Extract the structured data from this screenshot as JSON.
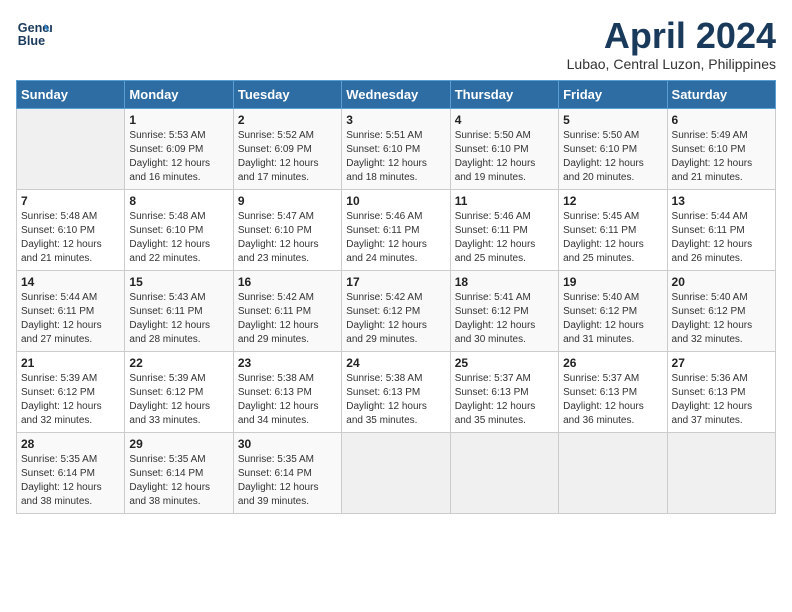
{
  "logo": {
    "line1": "General",
    "line2": "Blue"
  },
  "title": "April 2024",
  "subtitle": "Lubao, Central Luzon, Philippines",
  "headers": [
    "Sunday",
    "Monday",
    "Tuesday",
    "Wednesday",
    "Thursday",
    "Friday",
    "Saturday"
  ],
  "weeks": [
    [
      {
        "day": "",
        "info": ""
      },
      {
        "day": "1",
        "info": "Sunrise: 5:53 AM\nSunset: 6:09 PM\nDaylight: 12 hours\nand 16 minutes."
      },
      {
        "day": "2",
        "info": "Sunrise: 5:52 AM\nSunset: 6:09 PM\nDaylight: 12 hours\nand 17 minutes."
      },
      {
        "day": "3",
        "info": "Sunrise: 5:51 AM\nSunset: 6:10 PM\nDaylight: 12 hours\nand 18 minutes."
      },
      {
        "day": "4",
        "info": "Sunrise: 5:50 AM\nSunset: 6:10 PM\nDaylight: 12 hours\nand 19 minutes."
      },
      {
        "day": "5",
        "info": "Sunrise: 5:50 AM\nSunset: 6:10 PM\nDaylight: 12 hours\nand 20 minutes."
      },
      {
        "day": "6",
        "info": "Sunrise: 5:49 AM\nSunset: 6:10 PM\nDaylight: 12 hours\nand 21 minutes."
      }
    ],
    [
      {
        "day": "7",
        "info": "Sunrise: 5:48 AM\nSunset: 6:10 PM\nDaylight: 12 hours\nand 21 minutes."
      },
      {
        "day": "8",
        "info": "Sunrise: 5:48 AM\nSunset: 6:10 PM\nDaylight: 12 hours\nand 22 minutes."
      },
      {
        "day": "9",
        "info": "Sunrise: 5:47 AM\nSunset: 6:10 PM\nDaylight: 12 hours\nand 23 minutes."
      },
      {
        "day": "10",
        "info": "Sunrise: 5:46 AM\nSunset: 6:11 PM\nDaylight: 12 hours\nand 24 minutes."
      },
      {
        "day": "11",
        "info": "Sunrise: 5:46 AM\nSunset: 6:11 PM\nDaylight: 12 hours\nand 25 minutes."
      },
      {
        "day": "12",
        "info": "Sunrise: 5:45 AM\nSunset: 6:11 PM\nDaylight: 12 hours\nand 25 minutes."
      },
      {
        "day": "13",
        "info": "Sunrise: 5:44 AM\nSunset: 6:11 PM\nDaylight: 12 hours\nand 26 minutes."
      }
    ],
    [
      {
        "day": "14",
        "info": "Sunrise: 5:44 AM\nSunset: 6:11 PM\nDaylight: 12 hours\nand 27 minutes."
      },
      {
        "day": "15",
        "info": "Sunrise: 5:43 AM\nSunset: 6:11 PM\nDaylight: 12 hours\nand 28 minutes."
      },
      {
        "day": "16",
        "info": "Sunrise: 5:42 AM\nSunset: 6:11 PM\nDaylight: 12 hours\nand 29 minutes."
      },
      {
        "day": "17",
        "info": "Sunrise: 5:42 AM\nSunset: 6:12 PM\nDaylight: 12 hours\nand 29 minutes."
      },
      {
        "day": "18",
        "info": "Sunrise: 5:41 AM\nSunset: 6:12 PM\nDaylight: 12 hours\nand 30 minutes."
      },
      {
        "day": "19",
        "info": "Sunrise: 5:40 AM\nSunset: 6:12 PM\nDaylight: 12 hours\nand 31 minutes."
      },
      {
        "day": "20",
        "info": "Sunrise: 5:40 AM\nSunset: 6:12 PM\nDaylight: 12 hours\nand 32 minutes."
      }
    ],
    [
      {
        "day": "21",
        "info": "Sunrise: 5:39 AM\nSunset: 6:12 PM\nDaylight: 12 hours\nand 32 minutes."
      },
      {
        "day": "22",
        "info": "Sunrise: 5:39 AM\nSunset: 6:12 PM\nDaylight: 12 hours\nand 33 minutes."
      },
      {
        "day": "23",
        "info": "Sunrise: 5:38 AM\nSunset: 6:13 PM\nDaylight: 12 hours\nand 34 minutes."
      },
      {
        "day": "24",
        "info": "Sunrise: 5:38 AM\nSunset: 6:13 PM\nDaylight: 12 hours\nand 35 minutes."
      },
      {
        "day": "25",
        "info": "Sunrise: 5:37 AM\nSunset: 6:13 PM\nDaylight: 12 hours\nand 35 minutes."
      },
      {
        "day": "26",
        "info": "Sunrise: 5:37 AM\nSunset: 6:13 PM\nDaylight: 12 hours\nand 36 minutes."
      },
      {
        "day": "27",
        "info": "Sunrise: 5:36 AM\nSunset: 6:13 PM\nDaylight: 12 hours\nand 37 minutes."
      }
    ],
    [
      {
        "day": "28",
        "info": "Sunrise: 5:35 AM\nSunset: 6:14 PM\nDaylight: 12 hours\nand 38 minutes."
      },
      {
        "day": "29",
        "info": "Sunrise: 5:35 AM\nSunset: 6:14 PM\nDaylight: 12 hours\nand 38 minutes."
      },
      {
        "day": "30",
        "info": "Sunrise: 5:35 AM\nSunset: 6:14 PM\nDaylight: 12 hours\nand 39 minutes."
      },
      {
        "day": "",
        "info": ""
      },
      {
        "day": "",
        "info": ""
      },
      {
        "day": "",
        "info": ""
      },
      {
        "day": "",
        "info": ""
      }
    ]
  ]
}
